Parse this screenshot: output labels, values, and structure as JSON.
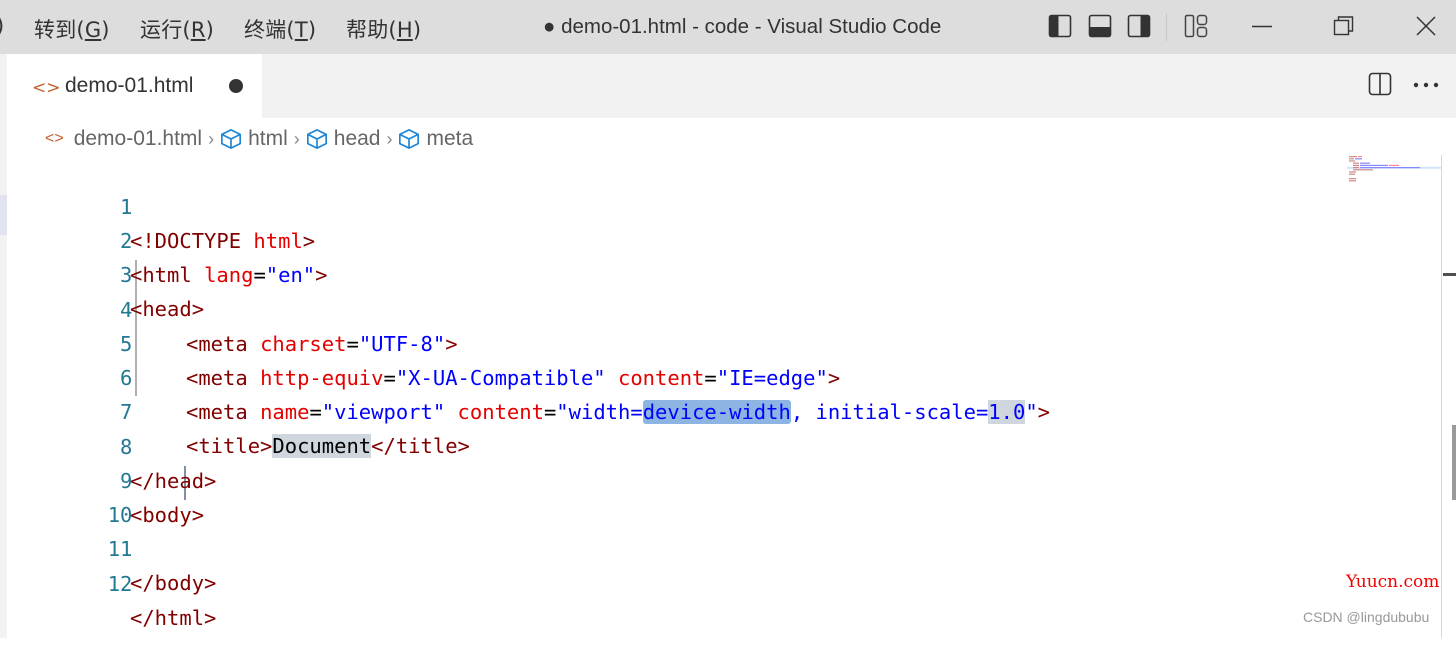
{
  "titlebar": {
    "menu": [
      {
        "label": "转到",
        "accel": "G"
      },
      {
        "label": "运行",
        "accel": "R"
      },
      {
        "label": "终端",
        "accel": "T"
      },
      {
        "label": "帮助",
        "accel": "H"
      }
    ],
    "partial_menu_edge": ")",
    "window_title": "● demo-01.html - code - Visual Studio Code",
    "layout_icons": [
      "toggle-primary-sidebar-icon",
      "toggle-panel-icon",
      "toggle-secondary-sidebar-icon",
      "customize-layout-icon"
    ],
    "window_controls": [
      "minimize-icon",
      "restore-icon",
      "close-icon"
    ]
  },
  "tabs": [
    {
      "label": "demo-01.html",
      "icon": "html-file-icon",
      "dirty": true,
      "active": true
    }
  ],
  "editor_actions": [
    "split-editor-icon",
    "more-actions-icon"
  ],
  "breadcrumb": [
    {
      "label": "demo-01.html",
      "icon": "html-file-icon"
    },
    {
      "label": "html",
      "icon": "symbol-element-icon"
    },
    {
      "label": "head",
      "icon": "symbol-element-icon"
    },
    {
      "label": "meta",
      "icon": "symbol-element-icon"
    }
  ],
  "code_lines": [
    {
      "n": "1"
    },
    {
      "n": "2"
    },
    {
      "n": "3"
    },
    {
      "n": "4"
    },
    {
      "n": "5"
    },
    {
      "n": "6"
    },
    {
      "n": "7"
    },
    {
      "n": "8"
    },
    {
      "n": "9"
    },
    {
      "n": "10"
    },
    {
      "n": "11"
    },
    {
      "n": "12"
    }
  ],
  "code": {
    "l1": [
      "<!DOCTYPE ",
      "html",
      ">"
    ],
    "l2": [
      "<html ",
      "lang",
      "=",
      "\"en\"",
      ">"
    ],
    "l3": [
      "<head>"
    ],
    "l4": [
      "<meta ",
      "charset",
      "=",
      "\"UTF-8\"",
      ">"
    ],
    "l5": [
      "<meta ",
      "http-equiv",
      "=",
      "\"X-UA-Compatible\"",
      " ",
      "content",
      "=",
      "\"IE=edge\"",
      ">"
    ],
    "l6": [
      "<meta ",
      "name",
      "=",
      "\"viewport\"",
      " ",
      "content",
      "=",
      "\"width=",
      "device-width",
      ", initial-scale=",
      "1.0",
      "\"",
      ">"
    ],
    "l7": [
      "<title>",
      "Document",
      "</title>"
    ],
    "l8": [
      "</head>"
    ],
    "l9": [
      "<body>"
    ],
    "l11": [
      "</body>"
    ],
    "l12": [
      "</html>"
    ]
  },
  "watermarks": {
    "site": "Yuucn.com",
    "author": "CSDN @lingdububu"
  }
}
